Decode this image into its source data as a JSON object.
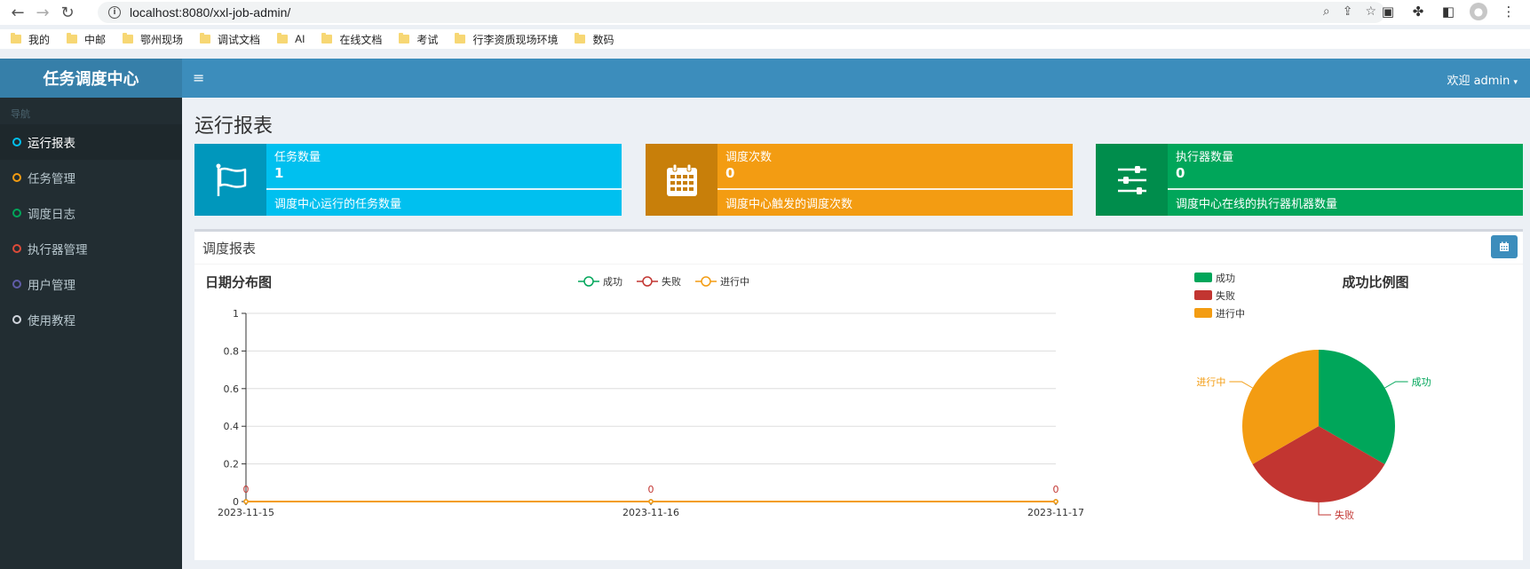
{
  "browser": {
    "url": "localhost:8080/xxl-job-admin/",
    "bookmarks": [
      "我的",
      "中邮",
      "鄂州现场",
      "调试文档",
      "AI",
      "在线文档",
      "考试",
      "行李资质现场环境",
      "数码"
    ]
  },
  "sidebar": {
    "logo": "任务调度中心",
    "nav_header": "导航",
    "items": [
      {
        "label": "运行报表",
        "color": "#00c0ef"
      },
      {
        "label": "任务管理",
        "color": "#f39c12"
      },
      {
        "label": "调度日志",
        "color": "#00a65a"
      },
      {
        "label": "执行器管理",
        "color": "#dd4b39"
      },
      {
        "label": "用户管理",
        "color": "#605ca8"
      },
      {
        "label": "使用教程",
        "color": "#d2d6de"
      }
    ]
  },
  "header": {
    "welcome": "欢迎 admin"
  },
  "page": {
    "title": "运行报表"
  },
  "info_boxes": [
    {
      "label": "任务数量",
      "value": "1",
      "desc": "调度中心运行的任务数量",
      "color": "#00c0ef",
      "icon_color": "#0097bc",
      "icon": "flag-icon"
    },
    {
      "label": "调度次数",
      "value": "0",
      "desc": "调度中心触发的调度次数",
      "color": "#f39c12",
      "icon_color": "#c87f0a",
      "icon": "calendar-icon"
    },
    {
      "label": "执行器数量",
      "value": "0",
      "desc": "调度中心在线的执行器机器数量",
      "color": "#00a65a",
      "icon_color": "#008d4c",
      "icon": "sliders-icon"
    }
  ],
  "report": {
    "title": "调度报表"
  },
  "chart_data": [
    {
      "type": "line",
      "title": "日期分布图",
      "x": [
        "2023-11-15",
        "2023-11-16",
        "2023-11-17"
      ],
      "series": [
        {
          "name": "成功",
          "values": [
            0,
            0,
            0
          ],
          "color": "#00a65a"
        },
        {
          "name": "失败",
          "values": [
            0,
            0,
            0
          ],
          "color": "#c23531"
        },
        {
          "name": "进行中",
          "values": [
            0,
            0,
            0
          ],
          "color": "#f39c12"
        }
      ],
      "yticks": [
        "0",
        "0.2",
        "0.4",
        "0.6",
        "0.8",
        "1"
      ],
      "ylim": [
        0,
        1
      ],
      "data_labels": [
        "0",
        "0",
        "0"
      ],
      "legend": "top-center"
    },
    {
      "type": "pie",
      "title": "成功比例图",
      "slices": [
        {
          "name": "成功",
          "value": 1,
          "color": "#00a65a"
        },
        {
          "name": "失败",
          "value": 1,
          "color": "#c23531"
        },
        {
          "name": "进行中",
          "value": 1,
          "color": "#f39c12"
        }
      ],
      "legend": "top-left"
    }
  ]
}
